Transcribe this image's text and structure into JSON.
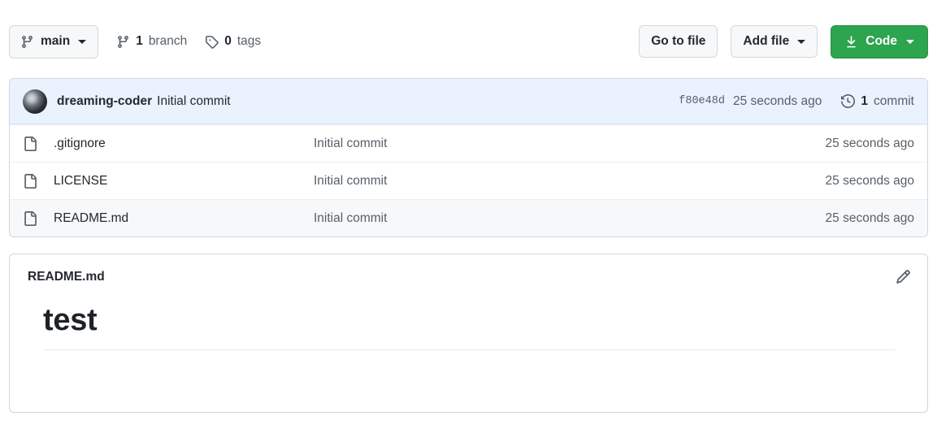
{
  "toolbar": {
    "branch_button": {
      "label": "main",
      "icon": "git-branch-icon",
      "caret": "chevron-down-icon"
    },
    "branches": {
      "count": "1",
      "label": "branch",
      "icon": "git-branch-icon"
    },
    "tags": {
      "count": "0",
      "label": "tags",
      "icon": "tag-icon"
    },
    "go_to_file": "Go to file",
    "add_file": "Add file",
    "code": "Code",
    "code_icon": "download-icon",
    "code_color": "#2da44e"
  },
  "commit_bar": {
    "avatar": "avatar",
    "author": "dreaming-coder",
    "message": "Initial commit",
    "sha": "f80e48d",
    "time": "25 seconds ago",
    "history_icon": "history-icon",
    "commit_count": "1",
    "commit_label": "commit",
    "background": "#eaf2fd"
  },
  "files": [
    {
      "icon": "file-icon",
      "name": ".gitignore",
      "message": "Initial commit",
      "time": "25 seconds ago",
      "hover": false
    },
    {
      "icon": "file-icon",
      "name": "LICENSE",
      "message": "Initial commit",
      "time": "25 seconds ago",
      "hover": false
    },
    {
      "icon": "file-icon",
      "name": "README.md",
      "message": "Initial commit",
      "time": "25 seconds ago",
      "hover": true
    }
  ],
  "readme": {
    "title": "README.md",
    "edit_icon": "pencil-icon",
    "heading": "test"
  }
}
